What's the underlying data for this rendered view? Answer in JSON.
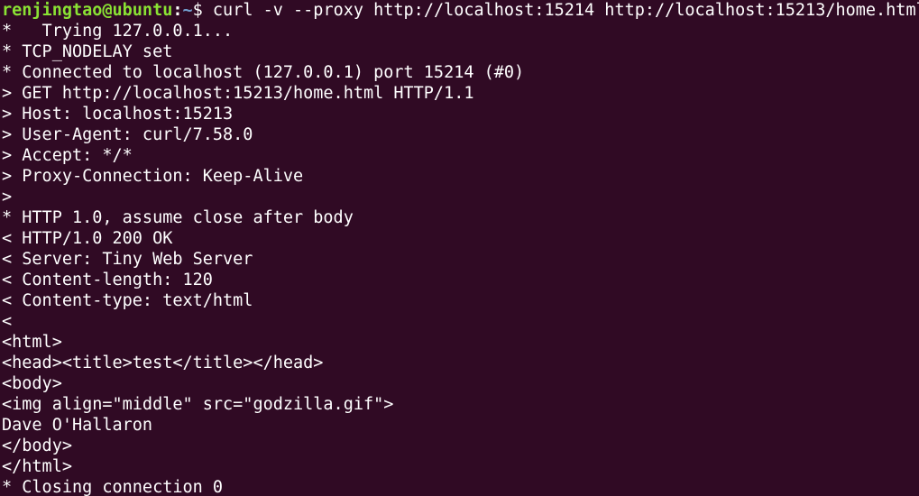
{
  "colors": {
    "background": "#300a24",
    "text": "#ffffff",
    "prompt_user": "#8ae234",
    "prompt_path": "#729fcf"
  },
  "prompt": {
    "user_host": "renjingtao@ubuntu",
    "separator": ":",
    "path": "~",
    "symbol": "$ ",
    "command": "curl -v --proxy http://localhost:15214 http://localhost:15213/home.html"
  },
  "output_lines": [
    "*   Trying 127.0.0.1...",
    "* TCP_NODELAY set",
    "* Connected to localhost (127.0.0.1) port 15214 (#0)",
    "> GET http://localhost:15213/home.html HTTP/1.1",
    "> Host: localhost:15213",
    "> User-Agent: curl/7.58.0",
    "> Accept: */*",
    "> Proxy-Connection: Keep-Alive",
    ">",
    "* HTTP 1.0, assume close after body",
    "< HTTP/1.0 200 OK",
    "< Server: Tiny Web Server",
    "< Content-length: 120",
    "< Content-type: text/html",
    "<",
    "<html>",
    "<head><title>test</title></head>",
    "<body>",
    "<img align=\"middle\" src=\"godzilla.gif\">",
    "Dave O'Hallaron",
    "</body>",
    "</html>",
    "* Closing connection 0"
  ]
}
